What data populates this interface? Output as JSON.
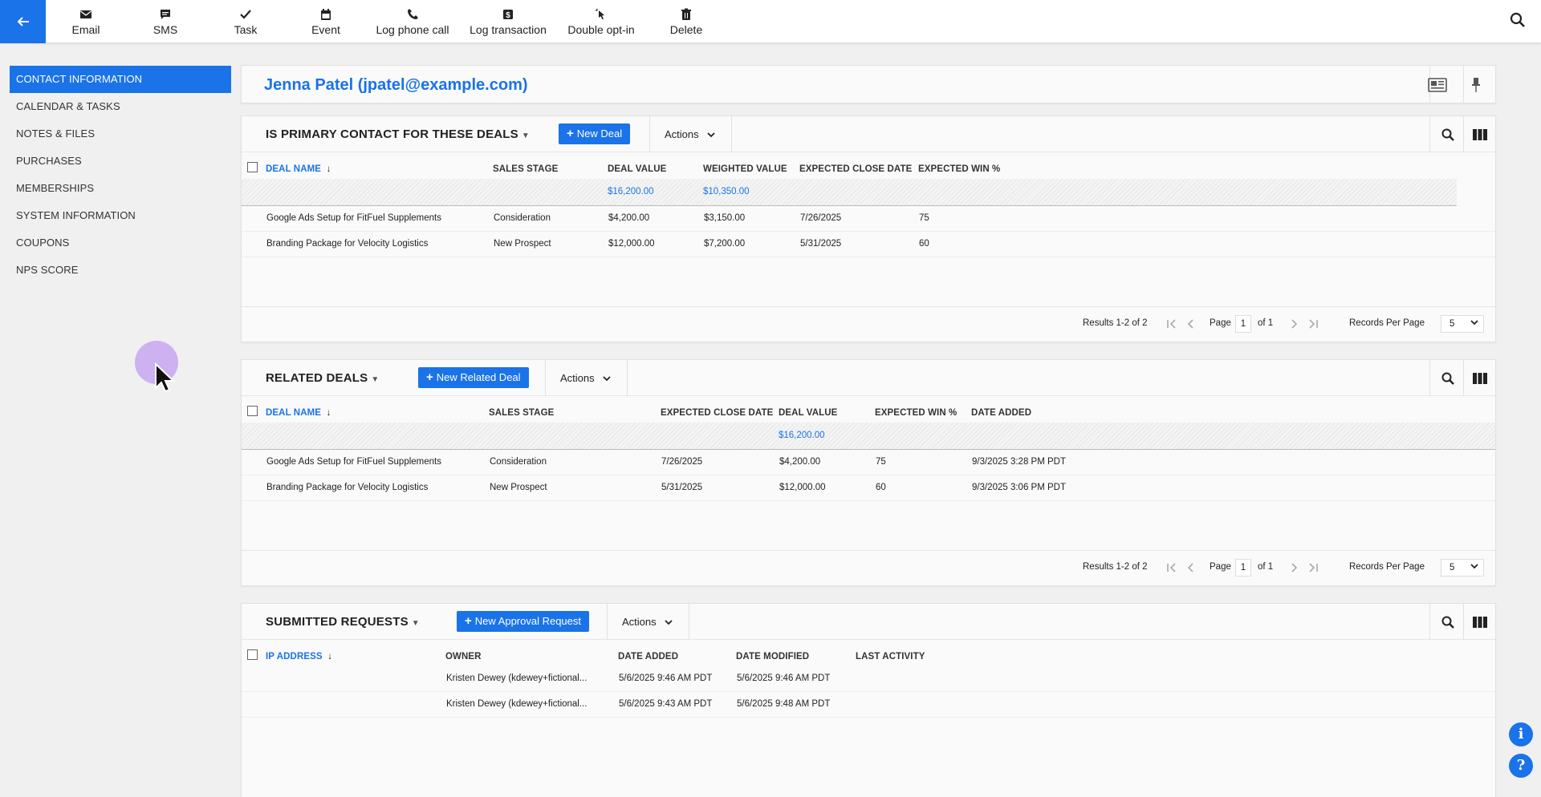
{
  "toolbar": {
    "items": [
      {
        "label": "Email",
        "icon": "envelope-icon"
      },
      {
        "label": "SMS",
        "icon": "chat-icon"
      },
      {
        "label": "Task",
        "icon": "checkmark-icon"
      },
      {
        "label": "Event",
        "icon": "calendar-icon"
      },
      {
        "label": "Log phone call",
        "icon": "phone-icon"
      },
      {
        "label": "Log transaction",
        "icon": "dollar-icon"
      },
      {
        "label": "Double opt-in",
        "icon": "cursor-click-icon"
      },
      {
        "label": "Delete",
        "icon": "trash-icon"
      }
    ]
  },
  "sidebar": {
    "items": [
      {
        "label": "CONTACT INFORMATION",
        "active": true
      },
      {
        "label": "CALENDAR & TASKS"
      },
      {
        "label": "NOTES & FILES"
      },
      {
        "label": "PURCHASES"
      },
      {
        "label": "MEMBERSHIPS"
      },
      {
        "label": "SYSTEM INFORMATION"
      },
      {
        "label": "COUPONS"
      },
      {
        "label": "NPS SCORE"
      }
    ]
  },
  "contact": {
    "name": "Jenna Patel (jpatel@example.com)"
  },
  "primary_deals": {
    "title": "IS PRIMARY CONTACT FOR THESE DEALS",
    "new_label": "New Deal",
    "actions_label": "Actions",
    "columns": [
      "DEAL NAME",
      "SALES STAGE",
      "DEAL VALUE",
      "WEIGHTED VALUE",
      "EXPECTED CLOSE DATE",
      "EXPECTED WIN %"
    ],
    "sort_arrow": "↓",
    "totals": {
      "deal_value": "$16,200.00",
      "weighted_value": "$10,350.00"
    },
    "rows": [
      [
        "Google Ads Setup for FitFuel Supplements",
        "Consideration",
        "$4,200.00",
        "$3,150.00",
        "7/26/2025",
        "75"
      ],
      [
        "Branding Package for Velocity Logistics",
        "New Prospect",
        "$12,000.00",
        "$7,200.00",
        "5/31/2025",
        "60"
      ]
    ],
    "pager": {
      "results": "Results 1-2 of 2",
      "page_label": "Page",
      "page": "1",
      "of": "of 1",
      "rpp_label": "Records Per Page",
      "rpp": "5"
    }
  },
  "related_deals": {
    "title": "RELATED DEALS",
    "new_label": "New Related Deal",
    "actions_label": "Actions",
    "columns": [
      "DEAL NAME",
      "SALES STAGE",
      "EXPECTED CLOSE DATE",
      "DEAL VALUE",
      "EXPECTED WIN %",
      "DATE ADDED"
    ],
    "sort_arrow": "↓",
    "totals": {
      "deal_value": "$16,200.00"
    },
    "rows": [
      [
        "Google Ads Setup for FitFuel Supplements",
        "Consideration",
        "7/26/2025",
        "$4,200.00",
        "75",
        "9/3/2025 3:28 PM PDT"
      ],
      [
        "Branding Package for Velocity Logistics",
        "New Prospect",
        "5/31/2025",
        "$12,000.00",
        "60",
        "9/3/2025 3:06 PM PDT"
      ]
    ],
    "pager": {
      "results": "Results 1-2 of 2",
      "page_label": "Page",
      "page": "1",
      "of": "of 1",
      "rpp_label": "Records Per Page",
      "rpp": "5"
    }
  },
  "submitted_requests": {
    "title": "SUBMITTED REQUESTS",
    "new_label": "New Approval Request",
    "actions_label": "Actions",
    "columns": [
      "IP ADDRESS",
      "OWNER",
      "DATE ADDED",
      "DATE MODIFIED",
      "LAST ACTIVITY"
    ],
    "sort_arrow": "↓",
    "rows": [
      [
        "",
        "Kristen Dewey (kdewey+fictional...",
        "5/6/2025 9:46 AM PDT",
        "5/6/2025 9:46 AM PDT",
        ""
      ],
      [
        "",
        "Kristen Dewey (kdewey+fictional...",
        "5/6/2025 9:43 AM PDT",
        "5/6/2025 9:48 AM PDT",
        ""
      ]
    ]
  },
  "fabs": {
    "info": "i",
    "help": "?"
  },
  "colors": {
    "accent": "#1a73e8",
    "cursor_halo": "#be96f0"
  }
}
